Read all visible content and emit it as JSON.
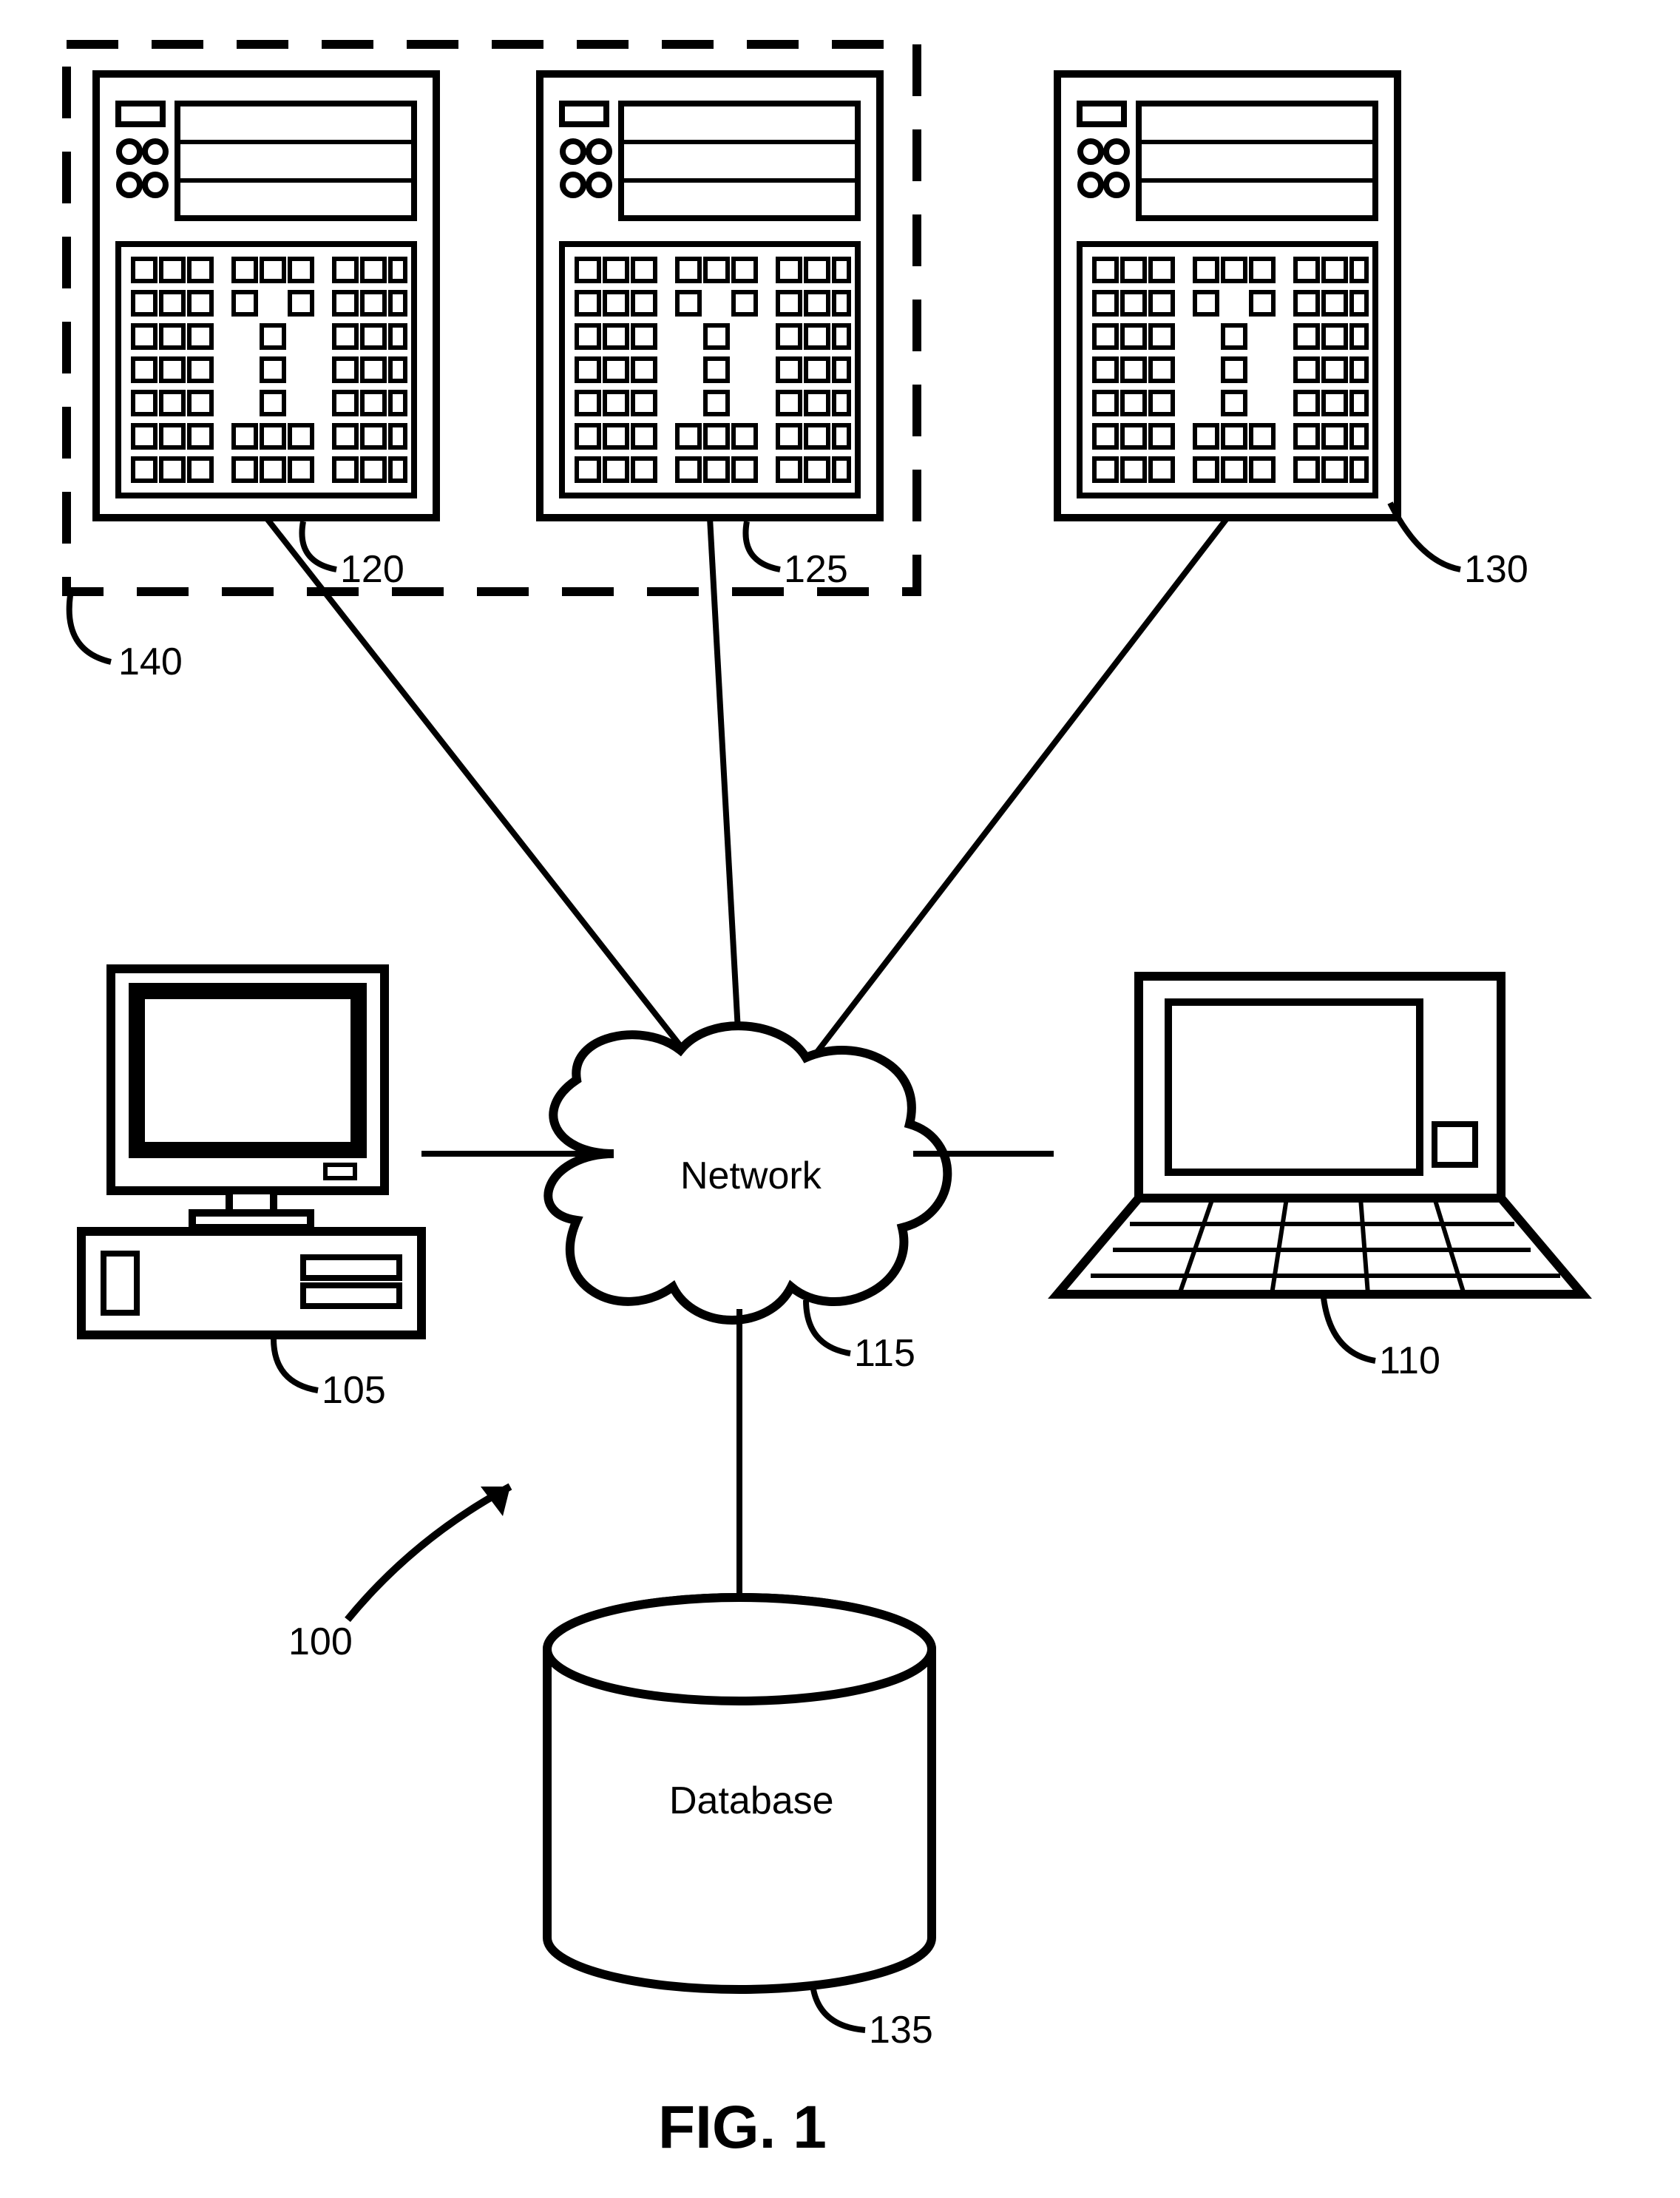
{
  "figure_title": "FIG. 1",
  "network_label": "Network",
  "database_label": "Database",
  "refs": {
    "system": "100",
    "desktop": "105",
    "laptop": "110",
    "network": "115",
    "server1": "120",
    "server2": "125",
    "server3": "130",
    "database": "135",
    "group": "140"
  }
}
